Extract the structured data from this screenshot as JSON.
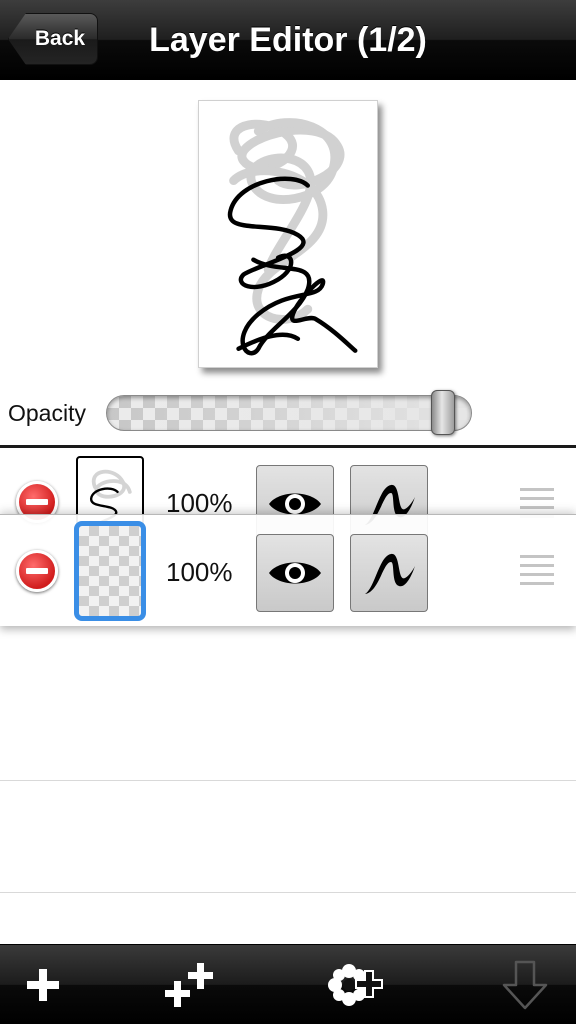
{
  "navbar": {
    "back_label": "Back",
    "title": "Layer Editor (1/2)"
  },
  "opacity": {
    "label": "Opacity",
    "value_fraction": 0.95
  },
  "layers": [
    {
      "opacity_text": "100%",
      "visible": true,
      "selected": false
    },
    {
      "opacity_text": "100%",
      "visible": true,
      "selected": true
    }
  ],
  "toolbar": {
    "icons": [
      "plus-icon",
      "add-multiple-icon",
      "add-effect-icon",
      "arrow-down-icon"
    ]
  },
  "colors": {
    "selection_blue": "#3a8ee6",
    "delete_red": "#d11d1d"
  }
}
